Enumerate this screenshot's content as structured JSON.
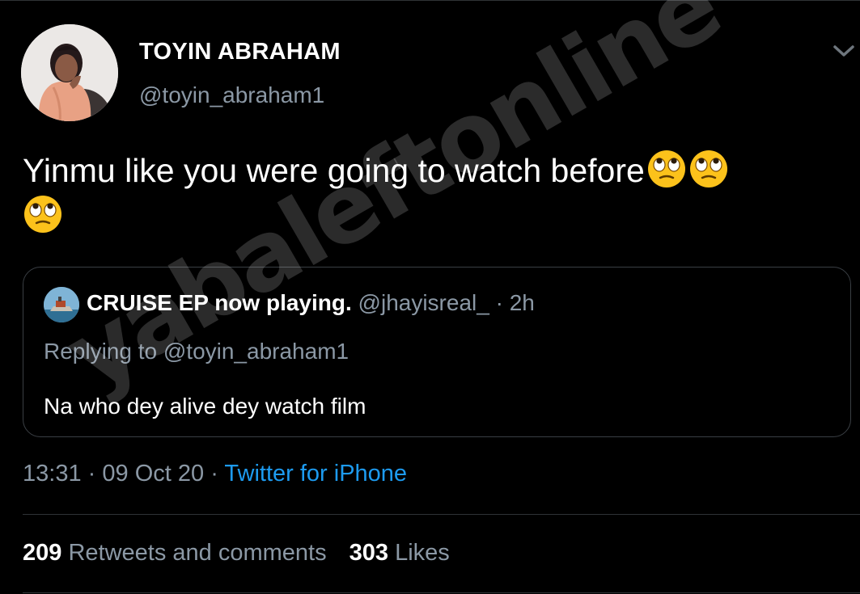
{
  "tweet": {
    "author_name": "TOYIN ABRAHAM",
    "author_handle": "@toyin_abraham1",
    "text": "Yinmu like you were going to watch before",
    "text_emojis": [
      "face-with-rolling-eyes",
      "face-with-rolling-eyes",
      "face-with-rolling-eyes"
    ],
    "time": "13:31",
    "date": "09 Oct 20",
    "separator": "·",
    "source": "Twitter for iPhone"
  },
  "quoted": {
    "author_name": "CRUISE EP now playing.",
    "author_handle": "@jhayisreal_",
    "separator": "·",
    "age": "2h",
    "replying_to": "Replying to @toyin_abraham1",
    "text": "Na who dey alive dey watch film"
  },
  "stats": {
    "retweets_count": "209",
    "retweets_label": "Retweets and comments",
    "likes_count": "303",
    "likes_label": "Likes"
  },
  "icons": {
    "menu": "chevron-down-icon",
    "emoji": "face-with-rolling-eyes"
  },
  "colors": {
    "background": "#000000",
    "primary_text": "#ffffff",
    "secondary_text": "#8b98a5",
    "link": "#1d9bf0",
    "divider": "#2f3336"
  },
  "watermark": "yabaleftonline"
}
